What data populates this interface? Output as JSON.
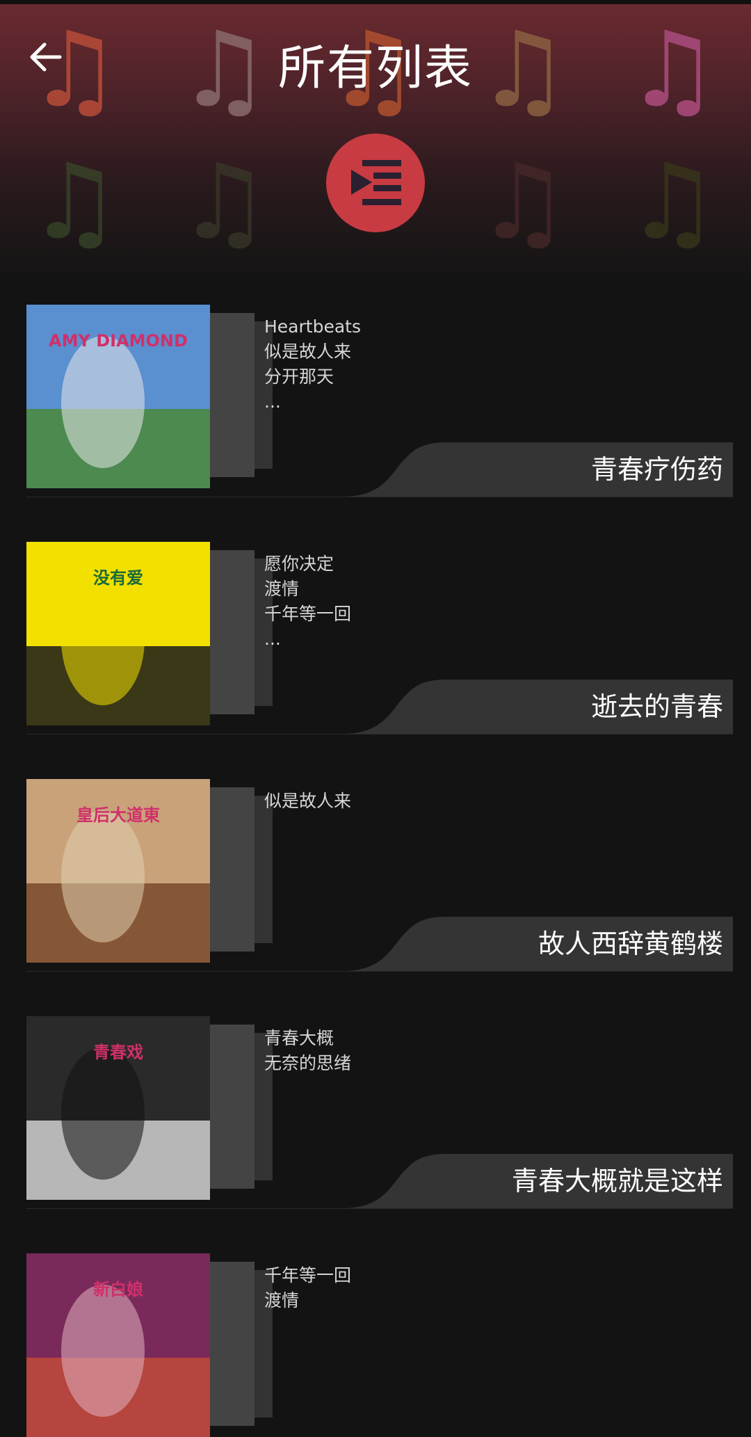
{
  "header": {
    "title": "所有列表",
    "back_icon": "arrow-left-icon",
    "play_all_icon": "playlist-play-icon",
    "accent_color": "#c83b42"
  },
  "playlists": [
    {
      "name": "青春疗伤药",
      "songs": [
        "Heartbeats",
        "似是故人来",
        "分开那天",
        "..."
      ],
      "cover_text": "AMY DIAMOND",
      "cover_colors": [
        "#5a8fd0",
        "#4a8a3a",
        "#e8e8e8"
      ]
    },
    {
      "name": "逝去的青春",
      "songs": [
        "愿你决定",
        "渡情",
        "千年等一回",
        "..."
      ],
      "cover_text": "没有爱",
      "cover_colors": [
        "#f2e000",
        "#1a1a1a",
        "#f2e000"
      ]
    },
    {
      "name": "故人西辞黄鹤楼",
      "songs": [
        "似是故人来"
      ],
      "cover_text": "皇后大道東",
      "cover_colors": [
        "#c9a27a",
        "#7a4a2a",
        "#e0d0b0"
      ]
    },
    {
      "name": "青春大概就是这样",
      "songs": [
        "青春大概",
        "无奈的思绪"
      ],
      "cover_text": "青春戏",
      "cover_colors": [
        "#2a2a2a",
        "#d0d0d0",
        "#111111"
      ]
    },
    {
      "name": "",
      "songs": [
        "千年等一回",
        "渡情"
      ],
      "cover_text": "新白娘",
      "cover_colors": [
        "#7a2a5a",
        "#c04a3a",
        "#e0b0c0"
      ]
    }
  ]
}
